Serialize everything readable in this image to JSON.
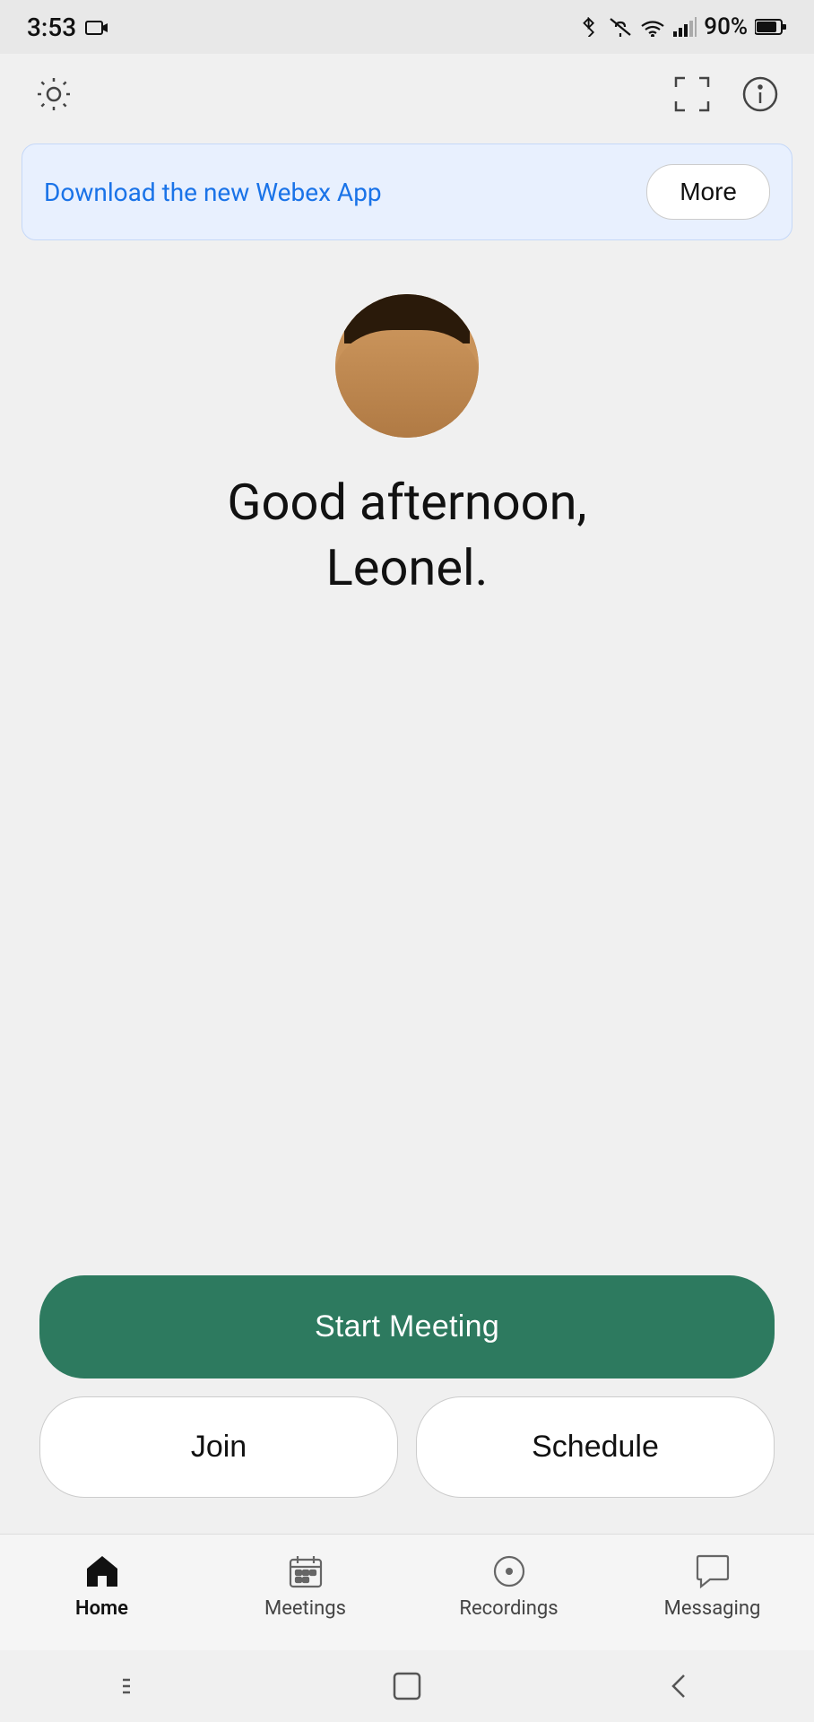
{
  "status_bar": {
    "time": "3:53",
    "battery": "90%"
  },
  "toolbar": {
    "settings_icon": "gear-icon",
    "scan_icon": "scan-icon",
    "info_icon": "info-icon"
  },
  "banner": {
    "text": "Download the new Webex App",
    "button_label": "More"
  },
  "greeting": {
    "line1": "Good afternoon,",
    "line2": "Leonel."
  },
  "buttons": {
    "start_meeting": "Start Meeting",
    "join": "Join",
    "schedule": "Schedule"
  },
  "bottom_nav": {
    "items": [
      {
        "id": "home",
        "label": "Home",
        "active": true
      },
      {
        "id": "meetings",
        "label": "Meetings",
        "active": false
      },
      {
        "id": "recordings",
        "label": "Recordings",
        "active": false
      },
      {
        "id": "messaging",
        "label": "Messaging",
        "active": false
      }
    ]
  }
}
